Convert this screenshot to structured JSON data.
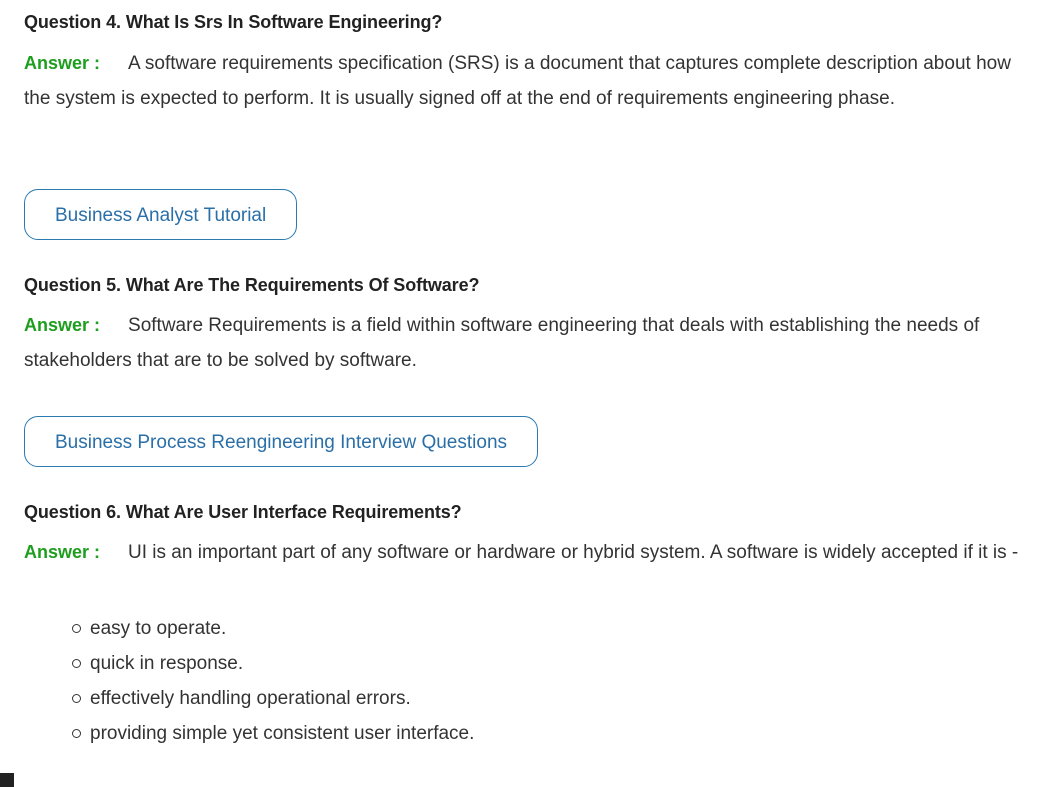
{
  "qa": [
    {
      "question": "Question 4. What Is Srs In Software Engineering?",
      "answer_label": "Answer :",
      "answer_text": "A software requirements specification (SRS) is a document that captures complete description about how the system is expected to perform. It is usually signed off at the end of requirements engineering phase.",
      "link_label": "Business Analyst Tutorial"
    },
    {
      "question": "Question 5. What Are The Requirements Of Software?",
      "answer_label": "Answer :",
      "answer_text": "Software Requirements is a field within software engineering that deals with establishing the needs of stakeholders that are to be solved by software.",
      "link_label": "Business Process Reengineering Interview Questions"
    },
    {
      "question": "Question 6. What Are User Interface Requirements?",
      "answer_label": "Answer :",
      "answer_text": "UI is an important part of any software or hardware or hybrid system. A software is widely accepted if it is -",
      "bullets": [
        "easy to operate.",
        "quick in response.",
        "effectively handling operational errors.",
        "providing simple yet consistent user interface."
      ]
    }
  ]
}
